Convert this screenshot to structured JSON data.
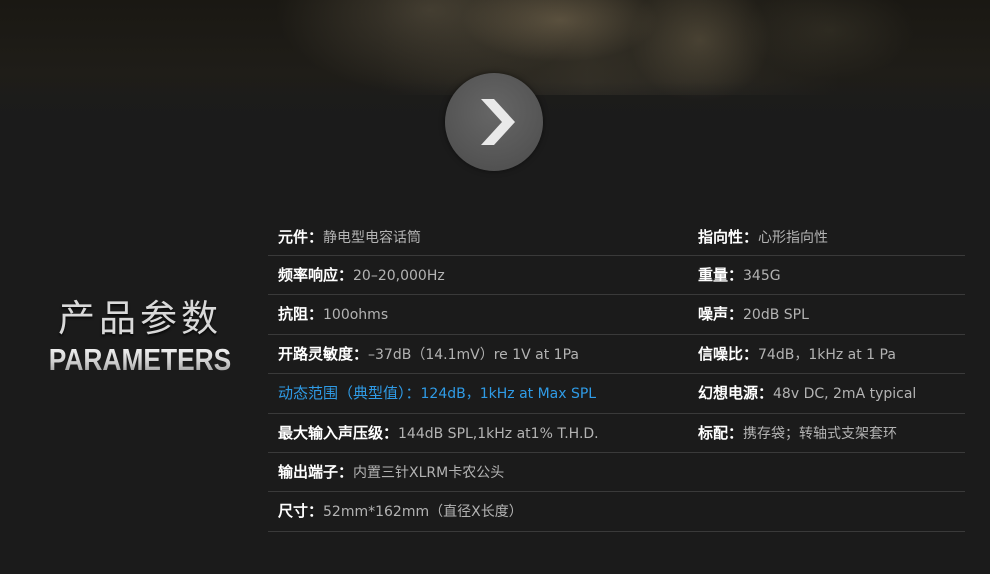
{
  "hero": {
    "next_icon": "chevron-right-icon"
  },
  "section": {
    "title_cn": "产品参数",
    "title_en": "PARAMETERS"
  },
  "specs": {
    "rows": [
      {
        "left": {
          "label": "元件：",
          "value": "静电型电容话筒"
        },
        "right": {
          "label": "指向性：",
          "value": "心形指向性"
        }
      },
      {
        "left": {
          "label": "频率响应：",
          "value": "20–20,000Hz"
        },
        "right": {
          "label": "重量：",
          "value": "345G"
        }
      },
      {
        "left": {
          "label": "抗阻：",
          "value": "100ohms"
        },
        "right": {
          "label": "噪声：",
          "value": "20dB SPL"
        }
      },
      {
        "left": {
          "label": "开路灵敏度：",
          "value": "–37dB（14.1mV）re 1V at 1Pa"
        },
        "right": {
          "label": "信噪比：",
          "value": "74dB，1kHz at 1 Pa"
        }
      },
      {
        "left": {
          "label": "动态范围（典型值）：",
          "value": "124dB，1kHz at Max SPL"
        },
        "right": {
          "label": "幻想电源：",
          "value": "48v DC, 2mA typical"
        }
      },
      {
        "left": {
          "label": "最大输入声压级：",
          "value": "144dB SPL,1kHz at1% T.H.D."
        },
        "right": {
          "label": "标配：",
          "value": "携存袋；转轴式支架套环"
        }
      },
      {
        "left": {
          "label": "输出端子：",
          "value": "内置三针XLRM卡农公头"
        }
      },
      {
        "left": {
          "label": "尺寸：",
          "value": "52mm*162mm（直径X长度）"
        }
      }
    ],
    "highlight_color": "#2f9be6"
  }
}
